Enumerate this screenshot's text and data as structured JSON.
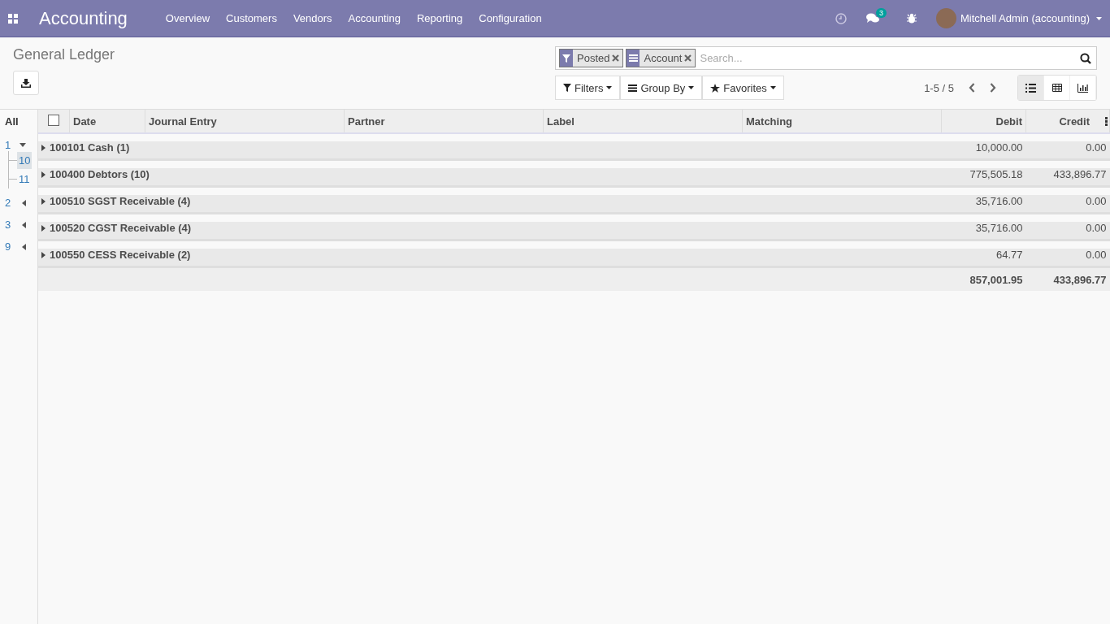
{
  "navbar": {
    "app_title": "Accounting",
    "menu": [
      "Overview",
      "Customers",
      "Vendors",
      "Accounting",
      "Reporting",
      "Configuration"
    ],
    "message_count": "3",
    "user": "Mitchell Admin (accounting)"
  },
  "breadcrumb": "General Ledger",
  "search": {
    "facets": [
      {
        "kind": "filter",
        "label": "Posted"
      },
      {
        "kind": "groupby",
        "label": "Account"
      }
    ],
    "placeholder": "Search..."
  },
  "search_buttons": [
    {
      "kind": "filter",
      "label": "Filters"
    },
    {
      "kind": "groupby",
      "label": "Group By"
    },
    {
      "kind": "favorite",
      "label": "Favorites"
    }
  ],
  "pager": "1-5 / 5",
  "views": [
    {
      "kind": "list",
      "selected": true
    },
    {
      "kind": "pivot",
      "selected": false
    },
    {
      "kind": "graph",
      "selected": false
    }
  ],
  "hierarchy": {
    "label": "All",
    "items": [
      {
        "label": "1",
        "expanded": true,
        "children": [
          {
            "label": "10",
            "selected": true
          },
          {
            "label": "11",
            "selected": false
          }
        ]
      },
      {
        "label": "2",
        "expanded": false
      },
      {
        "label": "3",
        "expanded": false
      },
      {
        "label": "9",
        "expanded": false
      }
    ]
  },
  "table": {
    "select_all_checked": false,
    "columns": [
      "Date",
      "Journal Entry",
      "Partner",
      "Label",
      "Matching",
      "Debit",
      "Credit"
    ],
    "groups": [
      {
        "name": "100101 Cash (1)",
        "debit": "10,000.00",
        "credit": "0.00"
      },
      {
        "name": "100400 Debtors (10)",
        "debit": "775,505.18",
        "credit": "433,896.77"
      },
      {
        "name": "100510 SGST Receivable (4)",
        "debit": "35,716.00",
        "credit": "0.00"
      },
      {
        "name": "100520 CGST Receivable (4)",
        "debit": "35,716.00",
        "credit": "0.00"
      },
      {
        "name": "100550 CESS Receivable (2)",
        "debit": "64.77",
        "credit": "0.00"
      }
    ],
    "totals": {
      "debit": "857,001.95",
      "credit": "433,896.77"
    }
  }
}
